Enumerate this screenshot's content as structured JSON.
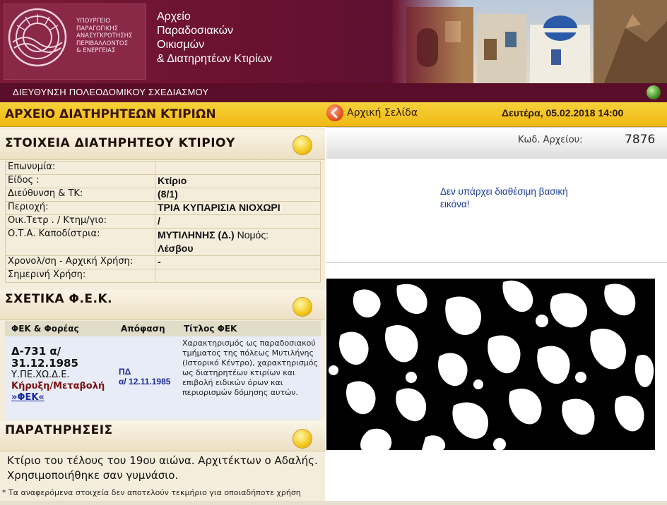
{
  "header": {
    "ministry_lines": [
      "ΥΠΟΥΡΓΕΙΟ",
      "ΠΑΡΑΓΩΓΙΚΗΣ",
      "ΑΝΑΣΥΓΚΡΟΤΗΣΗΣ",
      "ΠΕΡΙΒΑΛΛΟΝΤΟΣ",
      "& ΕΝΕΡΓΕΙΑΣ"
    ],
    "title_lines": [
      "Αρχείο",
      "Παραδοσιακών",
      "Οικισμών",
      "& Διατηρητέων Κτιρίων"
    ],
    "subbar": "ΔΙΕΥΘΥΝΣΗ ΠΟΛΕΟΔΟΜΙΚΟΥ ΣΧΕΔΙΑΣΜΟΥ",
    "globe_icon": "globe-icon"
  },
  "nav": {
    "archive_title": "ΑΡΧΕΙΟ ΔΙΑΤΗΡΗΤΕΩΝ ΚΤΙΡΙΩΝ",
    "home_label": "Αρχική Σελίδα",
    "datetime": "Δευτέρα, 05.02.2018 14:00"
  },
  "building": {
    "section_title": "ΣΤΟΙΧΕΙΑ ΔΙΑΤΗΡΗΤΕΟΥ ΚΤΙΡΙΟΥ",
    "rows": [
      {
        "label": "Επωνυμία:",
        "value": ""
      },
      {
        "label": "Είδος :",
        "value": "Κτίριο"
      },
      {
        "label": "Διεύθυνση & ΤΚ:",
        "value": "(8/1)"
      },
      {
        "label": "Περιοχή:",
        "value": "ΤΡΙΑ ΚΥΠΑΡΙΣΙΑ ΝΙΟΧΩΡΙ"
      },
      {
        "label": "Οικ.Τετρ . / Κτημ/γιο:",
        "value": "/"
      },
      {
        "label": "Ο.Τ.Α. Καποδίστρια:",
        "value": "ΜΥΤΙΛΗΝΗΣ (Δ.)",
        "value_suffix": " Νομός:",
        "value2": "Λέσβου"
      },
      {
        "label": "Χρονολ/ση - Αρχική Χρήση:",
        "value": "-"
      },
      {
        "label": "Σημερινή Χρήση:",
        "value": ""
      }
    ]
  },
  "fek": {
    "section_title": "ΣΧΕΤΙΚΑ Φ.Ε.Κ.",
    "headers": [
      "ΦΕΚ & Φορέας",
      "Απόφαση",
      "Τίτλος ΦΕΚ"
    ],
    "entry": {
      "code_line1": "Δ-731 α/",
      "code_line2": "31.12.1985",
      "org": "Υ.ΠΕ.ΧΩ.Δ.Ε.",
      "action": "Κήρυξη/Μεταβολή",
      "link": "»ΦΕΚ«",
      "decision_line1": "ΠΔ",
      "decision_line2": "α/ 12.11.1985",
      "title": "Χαρακτηρισμός ως παραδοσιακού τμήματος της πόλεως Μυτιλήνης (Ιστορικό Κέντρο), χαρακτηρισμός ως διατηρητέων κτιρίων και επιβολή ειδικών όρων και περιορισμών δόμησης αυτών."
    }
  },
  "remarks": {
    "section_title": "ΠΑΡΑΤΗΡΗΣΕΙΣ",
    "text": "Κτίριο του τέλους του 19ου αιώνα. Αρχιτέκτων ο Αδαλής. Χρησιμοποιήθηκε σαν γυμνάσιο.",
    "disclaimer": "* Τα αναφερόμενα στοιχεία δεν αποτελούν τεκμήριο για οποιαδήποτε χρήση"
  },
  "right": {
    "code_label": "Κωδ. Αρχείου:",
    "code_value": "7876",
    "no_image_text": "Δεν υπάρχει διαθέσιμη βασική εικόνα!"
  }
}
